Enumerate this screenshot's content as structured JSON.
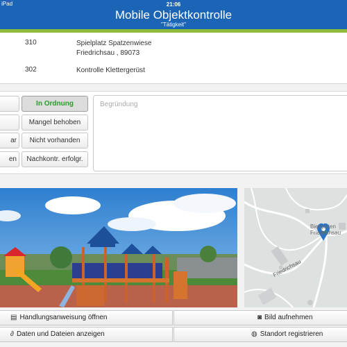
{
  "status": {
    "time": "21:06",
    "left": "iPad"
  },
  "header": {
    "title": "Mobile Objektkontrolle",
    "subtitle": "\"Tätigkeit\""
  },
  "info": {
    "row1": {
      "number": "310",
      "line1": "Spielplatz Spatzenwiese",
      "line2": "Friedrichsau , 89073"
    },
    "row2": {
      "number": "302",
      "line1": "Kontrolle Klettergerüst"
    }
  },
  "rating": {
    "left_buttons": [
      "",
      "",
      "ar",
      "en"
    ],
    "status_buttons": [
      {
        "label": "In Ordnung",
        "active": true
      },
      {
        "label": "Mangel behoben",
        "active": false
      },
      {
        "label": "Nicht vorhanden",
        "active": false
      },
      {
        "label": "Nachkontr. erfolgr.",
        "active": false
      }
    ],
    "reason_placeholder": "Begründung"
  },
  "map": {
    "street": "Friedrichsau",
    "poi": "Biergarten Friedrichsau"
  },
  "actions": {
    "instructions": "Handlungsanweisung öffnen",
    "take_photo": "Bild aufnehmen",
    "show_files": "Daten und Dateien anzeigen",
    "register_location": "Standort registrieren"
  },
  "icons": {
    "instructions": "document-list-icon",
    "camera": "camera-icon",
    "files": "paperclip-icon",
    "location": "globe-icon",
    "map_pin": "map-pin-icon"
  },
  "colors": {
    "header": "#1b64b6",
    "accent_green": "#8dbb3c",
    "ok_text": "#2a9a2a",
    "map_pin": "#2a74c8"
  }
}
